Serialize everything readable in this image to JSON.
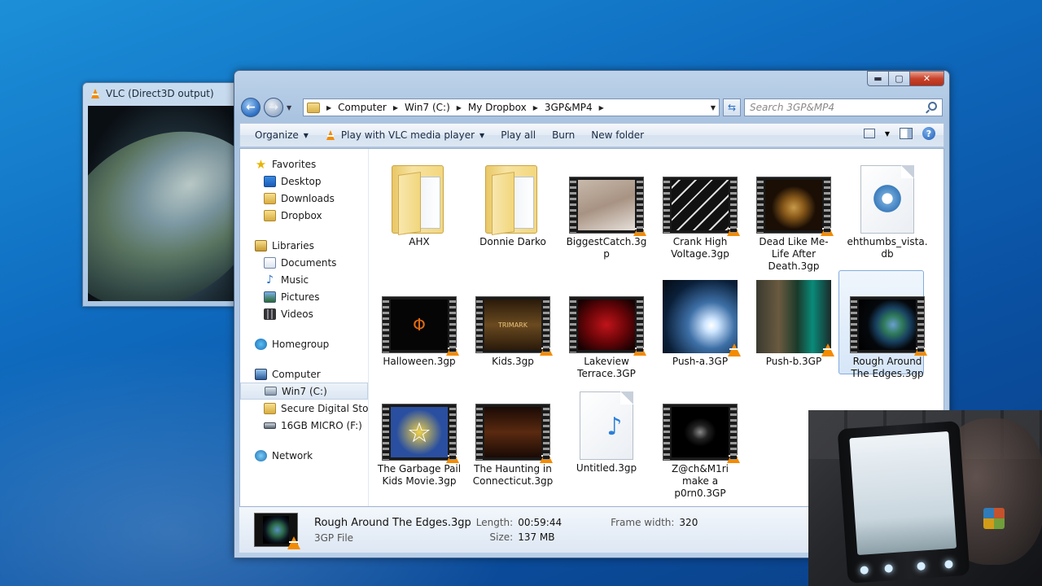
{
  "vlc": {
    "title": "VLC (Direct3D output)"
  },
  "explorer": {
    "controls": {
      "minimize": "▬",
      "maximize": "▢",
      "close": "✕"
    },
    "address": {
      "crumbs": [
        "Computer",
        "Win7 (C:)",
        "My Dropbox",
        "3GP&MP4"
      ]
    },
    "search": {
      "placeholder": "Search 3GP&MP4"
    },
    "toolbar": {
      "organize": "Organize",
      "play_with": "Play with VLC media player",
      "play_all": "Play all",
      "burn": "Burn",
      "new_folder": "New folder"
    },
    "nav": {
      "favorites": "Favorites",
      "desktop": "Desktop",
      "downloads": "Downloads",
      "dropbox": "Dropbox",
      "libraries": "Libraries",
      "documents": "Documents",
      "music": "Music",
      "pictures": "Pictures",
      "videos": "Videos",
      "homegroup": "Homegroup",
      "computer": "Computer",
      "win7": "Win7 (C:)",
      "secure": "Secure Digital Storag",
      "micro": "16GB MICRO (F:)",
      "network": "Network"
    },
    "files": [
      {
        "name": "AHX",
        "kind": "folder"
      },
      {
        "name": "Donnie Darko",
        "kind": "folder"
      },
      {
        "name": "BiggestCatch.3gp",
        "kind": "video"
      },
      {
        "name": "Crank High Voltage.3gp",
        "kind": "video"
      },
      {
        "name": "Dead Like Me-Life After Death.3gp",
        "kind": "video"
      },
      {
        "name": "ehthumbs_vista.db",
        "kind": "file"
      },
      {
        "name": "Halloween.3gp",
        "kind": "video"
      },
      {
        "name": "Kids.3gp",
        "kind": "video"
      },
      {
        "name": "Lakeview Terrace.3GP",
        "kind": "video"
      },
      {
        "name": "Push-a.3GP",
        "kind": "video"
      },
      {
        "name": "Push-b.3GP",
        "kind": "video"
      },
      {
        "name": "Rough Around The Edges.3gp",
        "kind": "video",
        "selected": true
      },
      {
        "name": "The Garbage Pail Kids Movie.3gp",
        "kind": "video"
      },
      {
        "name": "The Haunting in Connecticut.3gp",
        "kind": "video"
      },
      {
        "name": "Untitled.3gp",
        "kind": "media"
      },
      {
        "name": "Z@ch&M1ri make a p0rn0.3GP",
        "kind": "video"
      }
    ],
    "thumb_text": {
      "kids": "TRIMARK"
    },
    "details": {
      "name": "Rough Around The Edges.3gp",
      "type": "3GP File",
      "length_label": "Length:",
      "length": "00:59:44",
      "size_label": "Size:",
      "size": "137 MB",
      "frame_label": "Frame width:",
      "frame": "320"
    }
  },
  "colors": {
    "vlc_orange": "#f38b00",
    "selection_border": "#84acdd",
    "close_red": "#c9432b"
  }
}
